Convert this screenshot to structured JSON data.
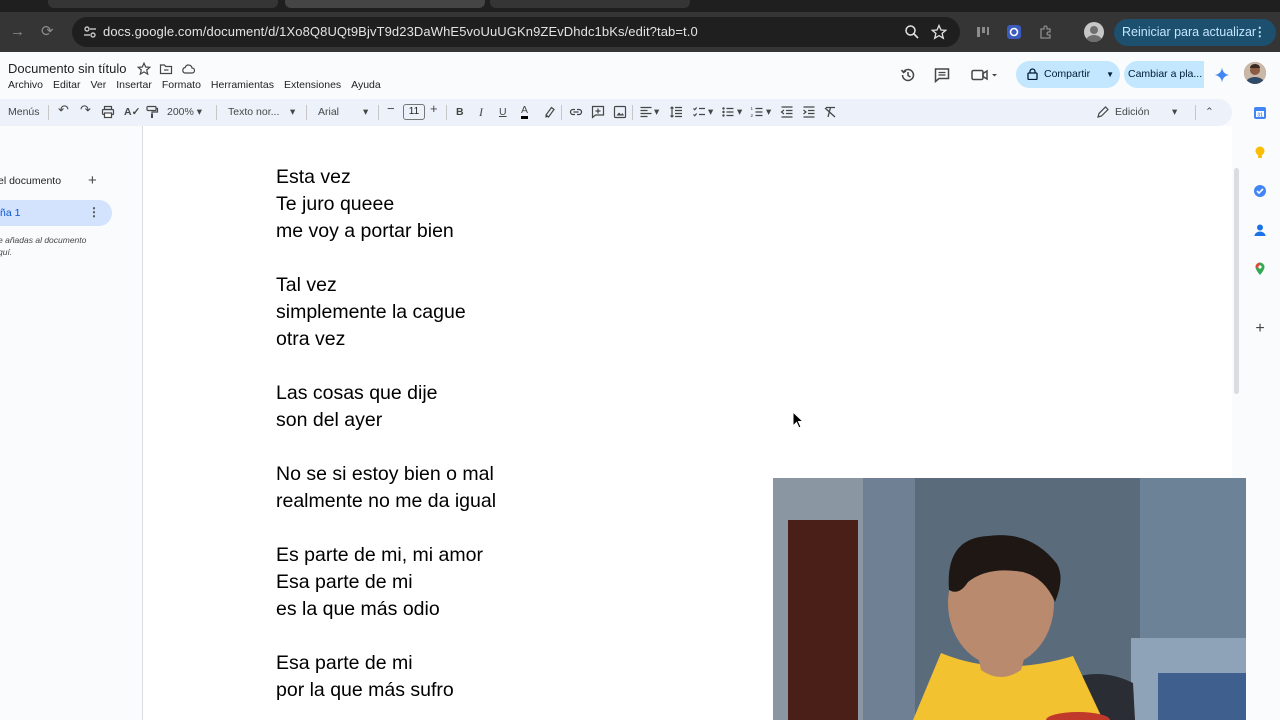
{
  "browser": {
    "url": "docs.google.com/document/d/1Xo8Q8UQt9BjvT9d23DaWhE5voUuUGKn9ZEvDhdc1bKs/edit?tab=t.0",
    "update_button": "Reiniciar para actualizar",
    "icons": [
      "back-icon",
      "reload-icon",
      "tune-icon",
      "zoom-icon",
      "star-icon",
      "extension-icon",
      "puzzle-icon",
      "profile-icon",
      "more-icon"
    ]
  },
  "docs": {
    "title": "Documento sin título",
    "menu": [
      "Archivo",
      "Editar",
      "Ver",
      "Insertar",
      "Formato",
      "Herramientas",
      "Extensiones",
      "Ayuda"
    ],
    "share_label": "Compartir",
    "switch_label": "Cambiar a pla...",
    "accent_color": "#c2e7ff"
  },
  "toolbar": {
    "menus_label": "Menús",
    "zoom": "200%",
    "style": "Texto nor...",
    "font": "Arial",
    "font_size": "11",
    "mode": "Edición"
  },
  "outline": {
    "header": "el documento",
    "tab_label": "ña 1",
    "note_line1": "e añadas al documento",
    "note_line2": "quí."
  },
  "document": {
    "lines": [
      "Esta vez",
      "Te juro queee",
      "me voy a portar bien",
      "",
      "Tal vez",
      "simplemente la cague",
      "otra vez",
      "",
      "Las cosas que dije",
      "son del ayer",
      "",
      "No se si estoy bien o mal",
      "realmente no me da igual",
      "",
      "Es parte de mi, mi amor",
      "Esa parte de mi",
      "es la que más odio",
      "",
      "Esa parte de mi",
      "por la que más sufro"
    ]
  }
}
